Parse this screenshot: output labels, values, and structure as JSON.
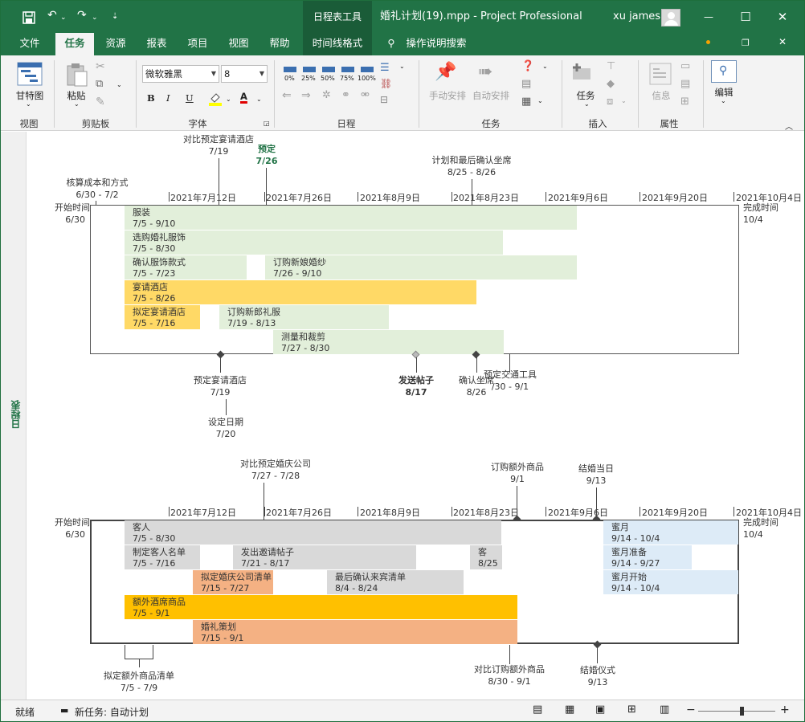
{
  "titlebar": {
    "context_tab": "日程表工具",
    "title": "婚礼计划(19).mpp  -  Project Professional",
    "user": "xu james",
    "minimize": "—",
    "restore": "☐",
    "close": "✕"
  },
  "tabs": [
    "文件",
    "任务",
    "资源",
    "报表",
    "项目",
    "视图",
    "帮助",
    "时间线格式"
  ],
  "tellme": "操作说明搜索",
  "ribbon": {
    "view_group": {
      "gantt": "甘特图",
      "label": "视图"
    },
    "clipboard": {
      "paste": "粘贴",
      "label": "剪贴板"
    },
    "font": {
      "face": "微软雅黑",
      "size": "8",
      "bold": "B",
      "italic": "I",
      "underline": "U",
      "color_a": "A",
      "label": "字体"
    },
    "schedule": {
      "pcts": [
        "0%",
        "25%",
        "50%",
        "75%",
        "100%"
      ],
      "label": "日程"
    },
    "tasks": {
      "manual": "手动安排",
      "auto": "自动安排",
      "label": "任务"
    },
    "insert": {
      "task": "任务",
      "label": "插入"
    },
    "props": {
      "info": "信息",
      "label": "属性"
    },
    "editing": {
      "edit": "编辑"
    }
  },
  "side_label": "日程表",
  "timeline1": {
    "dates": [
      "2021年7月12日",
      "2021年7月26日",
      "2021年8月9日",
      "2021年8月23日",
      "2021年9月6日",
      "2021年9月20日",
      "2021年10月4日"
    ],
    "start": {
      "label": "开始时间",
      "date": "6/30"
    },
    "finish": {
      "label": "完成时间",
      "date": "10/4"
    },
    "bars": [
      {
        "name": "服装",
        "dates": "7/5 - 9/10"
      },
      {
        "name": "选购婚礼服饰",
        "dates": "7/5 - 8/30"
      },
      {
        "name": "确认服饰款式",
        "dates": "7/5 - 7/23"
      },
      {
        "name": "订购新娘婚纱",
        "dates": "7/26 - 9/10"
      },
      {
        "name": "宴请酒店",
        "dates": "7/5 - 8/26"
      },
      {
        "name": "拟定宴请酒店",
        "dates": "7/5 - 7/16"
      },
      {
        "name": "订购新郎礼服",
        "dates": "7/19 - 8/13"
      },
      {
        "name": "测量和裁剪",
        "dates": "7/27 - 8/30"
      }
    ],
    "callouts_above": [
      {
        "name": "核算成本和方式",
        "dates": "6/30 - 7/2"
      },
      {
        "name": "对比预定宴请酒店",
        "dates": "7/19"
      },
      {
        "name": "预定",
        "dates": "7/26"
      },
      {
        "name": "计划和最后确认坐席",
        "dates": "8/25 - 8/26"
      }
    ],
    "callouts_below": [
      {
        "name": "预定宴请酒店",
        "dates": "7/19"
      },
      {
        "name": "设定日期",
        "dates": "7/20"
      },
      {
        "name": "发送帖子",
        "dates": "8/17"
      },
      {
        "name": "确认坐席",
        "dates": "8/26"
      },
      {
        "name": "预定交通工具",
        "dates": "/30 - 9/1"
      }
    ]
  },
  "timeline2": {
    "dates": [
      "2021年7月12日",
      "2021年7月26日",
      "2021年8月9日",
      "2021年8月23日",
      "2021年9月6日",
      "2021年9月20日",
      "2021年10月4日"
    ],
    "start": {
      "label": "开始时间",
      "date": "6/30"
    },
    "finish": {
      "label": "完成时间",
      "date": "10/4"
    },
    "bars": [
      {
        "name": "客人",
        "dates": "7/5 - 8/30"
      },
      {
        "name": "制定客人名单",
        "dates": "7/5 - 7/16"
      },
      {
        "name": "发出邀请帖子",
        "dates": "7/21 - 8/17"
      },
      {
        "name": "客",
        "dates": "8/25"
      },
      {
        "name": "拟定婚庆公司清单",
        "dates": "7/15 - 7/27"
      },
      {
        "name": "最后确认来宾清单",
        "dates": "8/4 - 8/24"
      },
      {
        "name": "额外酒席商品",
        "dates": "7/5 - 9/1"
      },
      {
        "name": "婚礼策划",
        "dates": "7/15 - 9/1"
      },
      {
        "name": "蜜月",
        "dates": "9/14 - 10/4"
      },
      {
        "name": "蜜月准备",
        "dates": "9/14 - 9/27"
      },
      {
        "name": "蜜月开始",
        "dates": "9/14 - 10/4"
      }
    ],
    "callouts_above": [
      {
        "name": "对比预定婚庆公司",
        "dates": "7/27 - 7/28"
      },
      {
        "name": "订购额外商品",
        "dates": "9/1"
      },
      {
        "name": "结婚当日",
        "dates": "9/13"
      }
    ],
    "callouts_below": [
      {
        "name": "拟定额外商品清单",
        "dates": "7/5 - 7/9"
      },
      {
        "name": "对比订购额外商品",
        "dates": "8/30 - 9/1"
      },
      {
        "name": "结婚仪式",
        "dates": "9/13"
      }
    ]
  },
  "status": {
    "ready": "就绪",
    "newtask": "新任务: 自动计划",
    "zoom_minus": "−",
    "zoom_plus": "+"
  },
  "colors": {
    "accent": "#217346",
    "green_bar": "#e2efda",
    "yellow_bar": "#ffd966",
    "orange_bar": "#f4b183",
    "grey_bar": "#d9d9d9",
    "blue_bar": "#ddebf7"
  }
}
